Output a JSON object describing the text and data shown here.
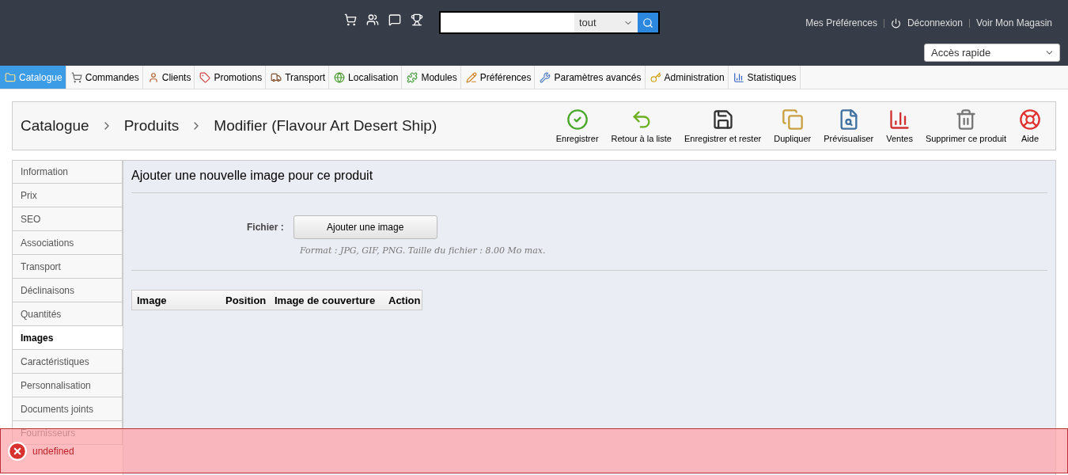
{
  "header": {
    "search": {
      "scope": "tout"
    },
    "links": [
      "Mes Préférences",
      "Déconnexion",
      "Voir Mon Magasin"
    ],
    "quick_access": "Accès rapide"
  },
  "nav": [
    {
      "label": "Catalogue",
      "selected": true,
      "kind": "folder"
    },
    {
      "label": "Commandes",
      "selected": false,
      "kind": "cart"
    },
    {
      "label": "Clients",
      "selected": false,
      "kind": "user"
    },
    {
      "label": "Promotions",
      "selected": false,
      "kind": "tag"
    },
    {
      "label": "Transport",
      "selected": false,
      "kind": "truck"
    },
    {
      "label": "Localisation",
      "selected": false,
      "kind": "globe"
    },
    {
      "label": "Modules",
      "selected": false,
      "kind": "puzzle"
    },
    {
      "label": "Préférences",
      "selected": false,
      "kind": "pencil"
    },
    {
      "label": "Paramètres avancés",
      "selected": false,
      "kind": "wrench"
    },
    {
      "label": "Administration",
      "selected": false,
      "kind": "key"
    },
    {
      "label": "Statistiques",
      "selected": false,
      "kind": "chart"
    }
  ],
  "breadcrumb": [
    "Catalogue",
    "Produits",
    "Modifier (Flavour Art Desert Ship)"
  ],
  "toolbar": [
    {
      "label": "Enregistrer",
      "kind": "check"
    },
    {
      "label": "Retour à la liste",
      "kind": "back"
    },
    {
      "label": "Enregistrer et rester",
      "kind": "save"
    },
    {
      "label": "Dupliquer",
      "kind": "copy"
    },
    {
      "label": "Prévisualiser",
      "kind": "preview"
    },
    {
      "label": "Ventes",
      "kind": "chart"
    },
    {
      "label": "Supprimer ce produit",
      "kind": "trash"
    },
    {
      "label": "Aide",
      "kind": "help"
    }
  ],
  "tabs": [
    {
      "label": "Information",
      "selected": false
    },
    {
      "label": "Prix",
      "selected": false
    },
    {
      "label": "SEO",
      "selected": false
    },
    {
      "label": "Associations",
      "selected": false
    },
    {
      "label": "Transport",
      "selected": false
    },
    {
      "label": "Déclinaisons",
      "selected": false
    },
    {
      "label": "Quantités",
      "selected": false
    },
    {
      "label": "Images",
      "selected": true
    },
    {
      "label": "Caractéristiques",
      "selected": false
    },
    {
      "label": "Personnalisation",
      "selected": false
    },
    {
      "label": "Documents joints",
      "selected": false
    },
    {
      "label": "Fournisseurs",
      "selected": false
    }
  ],
  "panel": {
    "title": "Ajouter une nouvelle image pour ce produit",
    "file_label": "Fichier :",
    "upload_button": "Ajouter une image",
    "hint": "Format : JPG, GIF, PNG. Taille du fichier : 8.00 Mo max.",
    "columns": [
      "Image",
      "Position",
      "Image de couverture",
      "Action"
    ]
  },
  "error": {
    "message": "undefined"
  }
}
